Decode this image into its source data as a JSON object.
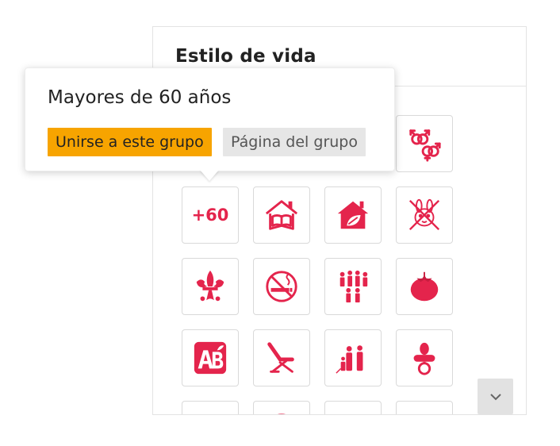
{
  "panel": {
    "title": "Estilo de vida"
  },
  "tooltip": {
    "title": "Mayores de 60 años",
    "join_label": "Unirse a este grupo",
    "page_label": "Página del grupo"
  },
  "grid": {
    "accent_color": "#e4244c",
    "tiles": [
      {
        "icon": "gender-symbols-icon"
      },
      {
        "label": "+60",
        "icon": "over-60-badge"
      },
      {
        "icon": "house-with-book-icon"
      },
      {
        "icon": "eco-house-icon"
      },
      {
        "icon": "no-animal-testing-icon"
      },
      {
        "icon": "scouts-fleur-de-lis-icon"
      },
      {
        "icon": "no-smoking-icon"
      },
      {
        "icon": "families-icon"
      },
      {
        "icon": "tomato-icon"
      },
      {
        "icon": "organic-ab-icon"
      },
      {
        "icon": "lounge-chair-icon"
      },
      {
        "icon": "parents-child-icon"
      },
      {
        "icon": "pacifier-icon"
      }
    ]
  },
  "scroll": {
    "icon": "chevron-down-icon"
  }
}
